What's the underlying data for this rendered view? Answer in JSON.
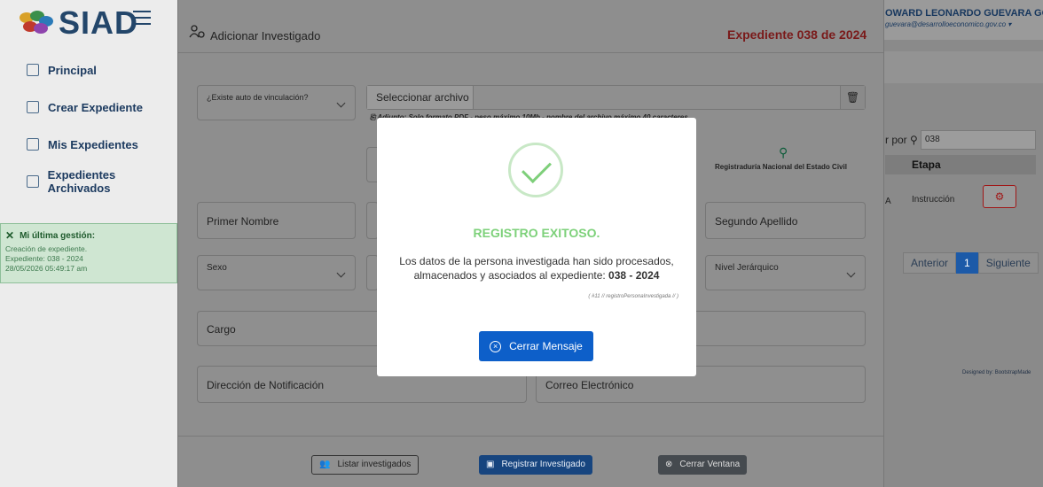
{
  "app": {
    "brand": "SIAD",
    "colors": {
      "brand": "#23466a",
      "success": "#7dd17a",
      "primary": "#0d5fc9",
      "danger": "#a01818"
    }
  },
  "user": {
    "name": "OWARD LEONARDO GUEVARA GOMEZ",
    "email": "guevara@desarrolloeconomico.gov.co"
  },
  "sidebar": {
    "items": [
      {
        "label": "Principal",
        "icon": "home-icon"
      },
      {
        "label": "Crear Expediente",
        "icon": "folder-icon"
      },
      {
        "label": "Mis Expedientes",
        "icon": "list-icon"
      },
      {
        "label": "Expedientes Archivados",
        "icon": "archive-icon"
      }
    ],
    "last_activity": {
      "title": "Mi última gestión:",
      "line1": "Creación de expediente.",
      "line2": "Expediente: 038 - 2024",
      "line3": "28/05/2026 05:49:17 am"
    }
  },
  "background": {
    "filter_label": "r por",
    "filter_value": "038",
    "table_header": "Etapa",
    "row_cell_a": "A",
    "row_cell_b": "Instrucción",
    "pager": {
      "prev": "Anterior",
      "page": "1",
      "next": "Siguiente"
    },
    "credit": "Designed by: BootstrapMade"
  },
  "form": {
    "title": "Adicionar Investigado",
    "expediente": "Expediente 038 de 2024",
    "vinculacion_label": "¿Existe auto de vinculación?",
    "file_button": "Seleccionar archivo",
    "file_hint": "Adjunto: Solo formato PDF - peso máximo 10Mb - nombre del archivo máximo 40 caracteres.",
    "registraduria": "Registraduría Nacional del Estado Civil",
    "primer_nombre": "Primer Nombre",
    "segundo_apellido": "Segundo Apellido",
    "sexo": "Sexo",
    "nivel": "Nivel Jerárquico",
    "cargo": "Cargo",
    "direccion": "Dirección de Notificación",
    "correo": "Correo Electrónico",
    "buttons": {
      "listar": "Listar investigados",
      "registrar": "Registrar Investigado",
      "cerrar": "Cerrar Ventana"
    }
  },
  "dialog": {
    "title": "REGISTRO EXITOSO.",
    "message": "Los datos de la persona investigada han sido procesados, almacenados y asociados al expediente:",
    "expediente": "038 - 2024",
    "ref": "( #11 // registroPersonaInvestigada // )",
    "button": "Cerrar Mensaje"
  }
}
